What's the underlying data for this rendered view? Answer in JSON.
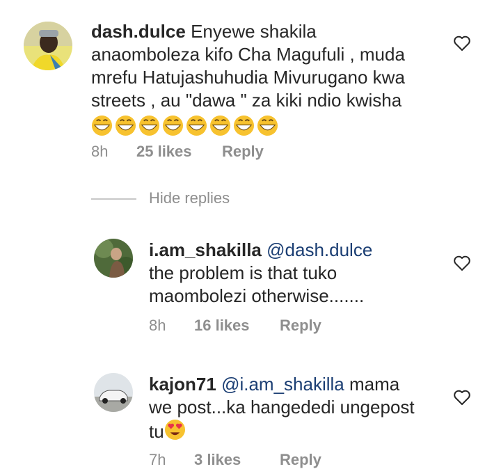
{
  "comments": [
    {
      "username": "dash.dulce",
      "mention": "",
      "text": "Enyewe shakila anaomboleza kifo Cha Magufuli , muda mrefu Hatujashuhudia Mivurugano kwa streets , au \"dawa \" za kiki ndio kwisha",
      "line1": "Enyewe shakila",
      "line2": "anaomboleza kifo Cha Magufuli , muda",
      "line3": "mrefu Hatujashuhudia Mivurugano kwa",
      "line4": "streets , au \"dawa \" za kiki ndio kwisha",
      "emojis": "😁😁😁😁😁😁😁😁",
      "time": "8h",
      "likes": "25 likes",
      "reply": "Reply"
    },
    {
      "username": "i.am_shakilla",
      "mention": "@dash.dulce",
      "line1": "the problem is that tuko",
      "line2": "maombolezi otherwise.......",
      "time": "8h",
      "likes": "16 likes",
      "reply": "Reply"
    },
    {
      "username": "kajon71",
      "mention": "@i.am_shakilla",
      "text_after_mention": " mama",
      "line2": "we post...ka hangededi ungepost",
      "line3": "tu",
      "emoji": "😍",
      "time": "7h",
      "likes": "3 likes",
      "reply": "Reply"
    }
  ],
  "hide_replies": "Hide replies",
  "icons": [
    "heart-outline-icon",
    "grinning-emoji-icon",
    "heart-eyes-emoji-icon"
  ],
  "colors": {
    "text": "#262626",
    "secondary": "#8e8e8e",
    "mention": "#1b3e73",
    "emoji": "#f7c22f"
  }
}
